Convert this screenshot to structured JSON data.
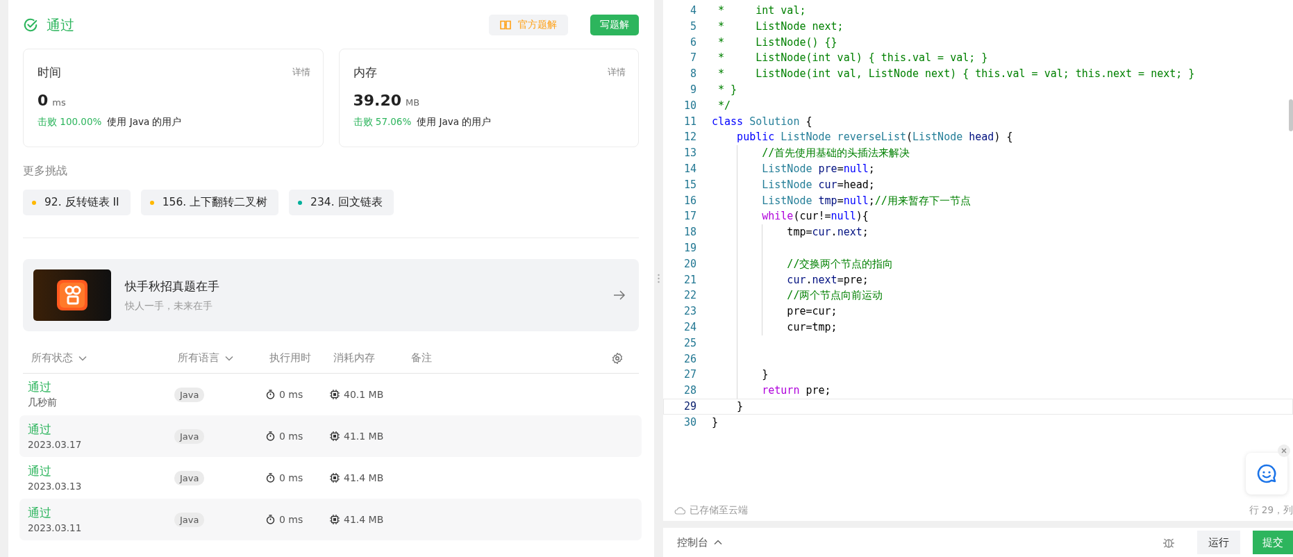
{
  "result": {
    "status": "通过",
    "official_button": "官方题解",
    "write_button": "写题解"
  },
  "stats": [
    {
      "title": "时间",
      "details": "详情",
      "value": "0",
      "unit": "ms",
      "beat": "击败 100.00%",
      "beat_suffix": "使用 Java 的用户"
    },
    {
      "title": "内存",
      "details": "详情",
      "value": "39.20",
      "unit": "MB",
      "beat": "击败 57.06%",
      "beat_suffix": "使用 Java 的用户"
    }
  ],
  "more": {
    "title": "更多挑战",
    "items": [
      {
        "label": "92. 反转链表 II",
        "color": "#ffb800"
      },
      {
        "label": "156. 上下翻转二叉树",
        "color": "#ffb800"
      },
      {
        "label": "234. 回文链表",
        "color": "#00af9b"
      }
    ]
  },
  "banner": {
    "title": "快手秋招真题在手",
    "subtitle": "快人一手，未来在手"
  },
  "table": {
    "columns": [
      {
        "label": "所有状态",
        "dropdown": true
      },
      {
        "label": "所有语言",
        "dropdown": true
      },
      {
        "label": "执行用时",
        "dropdown": false
      },
      {
        "label": "消耗内存",
        "dropdown": false
      },
      {
        "label": "备注",
        "dropdown": false
      }
    ],
    "rows": [
      {
        "status": "通过",
        "time_ago": "几秒前",
        "language": "Java",
        "runtime": "0 ms",
        "memory": "40.1 MB"
      },
      {
        "status": "通过",
        "time_ago": "2023.03.17",
        "language": "Java",
        "runtime": "0 ms",
        "memory": "41.1 MB"
      },
      {
        "status": "通过",
        "time_ago": "2023.03.13",
        "language": "Java",
        "runtime": "0 ms",
        "memory": "41.4 MB"
      },
      {
        "status": "通过",
        "time_ago": "2023.03.11",
        "language": "Java",
        "runtime": "0 ms",
        "memory": "41.4 MB"
      }
    ]
  },
  "editor": {
    "lines": [
      {
        "number": "4",
        "current": false,
        "tokens": [
          {
            "kind": "comment",
            "text": " *     int val;"
          }
        ]
      },
      {
        "number": "5",
        "current": false,
        "tokens": [
          {
            "kind": "comment",
            "text": " *     ListNode next;"
          }
        ]
      },
      {
        "number": "6",
        "current": false,
        "tokens": [
          {
            "kind": "comment",
            "text": " *     ListNode() {}"
          }
        ]
      },
      {
        "number": "7",
        "current": false,
        "tokens": [
          {
            "kind": "comment",
            "text": " *     ListNode(int val) { this.val = val; }"
          }
        ]
      },
      {
        "number": "8",
        "current": false,
        "tokens": [
          {
            "kind": "comment",
            "text": " *     ListNode(int val, ListNode next) { this.val = val; this.next = next; }"
          }
        ]
      },
      {
        "number": "9",
        "current": false,
        "tokens": [
          {
            "kind": "comment",
            "text": " * }"
          }
        ]
      },
      {
        "number": "10",
        "current": false,
        "tokens": [
          {
            "kind": "comment",
            "text": " */"
          }
        ]
      },
      {
        "number": "11",
        "current": false,
        "tokens": [
          {
            "kind": "keyword",
            "text": "class"
          },
          {
            "kind": "type",
            "text": " Solution"
          },
          {
            "kind": "plain",
            "text": " {"
          }
        ]
      },
      {
        "number": "12",
        "current": false,
        "tokens": [
          {
            "kind": "keyword",
            "text": "    public"
          },
          {
            "kind": "type",
            "text": " ListNode"
          },
          {
            "kind": "function",
            "text": " reverseList"
          },
          {
            "kind": "plain",
            "text": "("
          },
          {
            "kind": "type",
            "text": "ListNode"
          },
          {
            "kind": "variable",
            "text": " head"
          },
          {
            "kind": "plain",
            "text": ") {"
          }
        ]
      },
      {
        "number": "13",
        "current": false,
        "tokens": [
          {
            "kind": "comment",
            "text": "        //首先使用基础的头插法来解决"
          }
        ]
      },
      {
        "number": "14",
        "current": false,
        "tokens": [
          {
            "kind": "type",
            "text": "        ListNode"
          },
          {
            "kind": "variable",
            "text": " pre"
          },
          {
            "kind": "plain",
            "text": "="
          },
          {
            "kind": "keyword",
            "text": "null"
          },
          {
            "kind": "plain",
            "text": ";"
          }
        ]
      },
      {
        "number": "15",
        "current": false,
        "tokens": [
          {
            "kind": "type",
            "text": "        ListNode"
          },
          {
            "kind": "variable",
            "text": " cur"
          },
          {
            "kind": "plain",
            "text": "=head;"
          }
        ]
      },
      {
        "number": "16",
        "current": false,
        "tokens": [
          {
            "kind": "type",
            "text": "        ListNode"
          },
          {
            "kind": "variable",
            "text": " tmp"
          },
          {
            "kind": "plain",
            "text": "="
          },
          {
            "kind": "keyword",
            "text": "null"
          },
          {
            "kind": "plain",
            "text": ";"
          },
          {
            "kind": "comment",
            "text": "//用来暂存下一节点"
          }
        ]
      },
      {
        "number": "17",
        "current": false,
        "tokens": [
          {
            "kind": "control",
            "text": "        while"
          },
          {
            "kind": "plain",
            "text": "(cur!="
          },
          {
            "kind": "keyword",
            "text": "null"
          },
          {
            "kind": "plain",
            "text": "){"
          }
        ]
      },
      {
        "number": "18",
        "current": false,
        "tokens": [
          {
            "kind": "plain",
            "text": "            tmp="
          },
          {
            "kind": "variable",
            "text": "cur"
          },
          {
            "kind": "plain",
            "text": "."
          },
          {
            "kind": "variable",
            "text": "next"
          },
          {
            "kind": "plain",
            "text": ";"
          }
        ]
      },
      {
        "number": "19",
        "current": false
      },
      {
        "number": "20",
        "current": false,
        "tokens": [
          {
            "kind": "comment",
            "text": "            //交换两个节点的指向"
          }
        ]
      },
      {
        "number": "21",
        "current": false,
        "tokens": [
          {
            "kind": "variable",
            "text": "            cur"
          },
          {
            "kind": "plain",
            "text": "."
          },
          {
            "kind": "variable",
            "text": "next"
          },
          {
            "kind": "plain",
            "text": "=pre;"
          }
        ]
      },
      {
        "number": "22",
        "current": false,
        "tokens": [
          {
            "kind": "comment",
            "text": "            //两个节点向前运动"
          }
        ]
      },
      {
        "number": "23",
        "current": false,
        "tokens": [
          {
            "kind": "plain",
            "text": "            pre=cur;"
          }
        ]
      },
      {
        "number": "24",
        "current": false,
        "tokens": [
          {
            "kind": "plain",
            "text": "            cur=tmp;"
          }
        ]
      },
      {
        "number": "25",
        "current": false
      },
      {
        "number": "26",
        "current": false
      },
      {
        "number": "27",
        "current": false,
        "tokens": [
          {
            "kind": "plain",
            "text": "        }"
          }
        ]
      },
      {
        "number": "28",
        "current": false,
        "tokens": [
          {
            "kind": "control",
            "text": "        return"
          },
          {
            "kind": "plain",
            "text": " pre;"
          }
        ]
      },
      {
        "number": "29",
        "current": true,
        "tokens": [
          {
            "kind": "plain",
            "text": "    }"
          }
        ]
      },
      {
        "number": "30",
        "current": false,
        "tokens": [
          {
            "kind": "plain",
            "text": "}"
          }
        ]
      }
    ],
    "saved": "已存储至云端",
    "cursor": "行 29，列"
  },
  "console": {
    "label": "控制台",
    "run_button": "运行",
    "submit_button": "提交"
  }
}
